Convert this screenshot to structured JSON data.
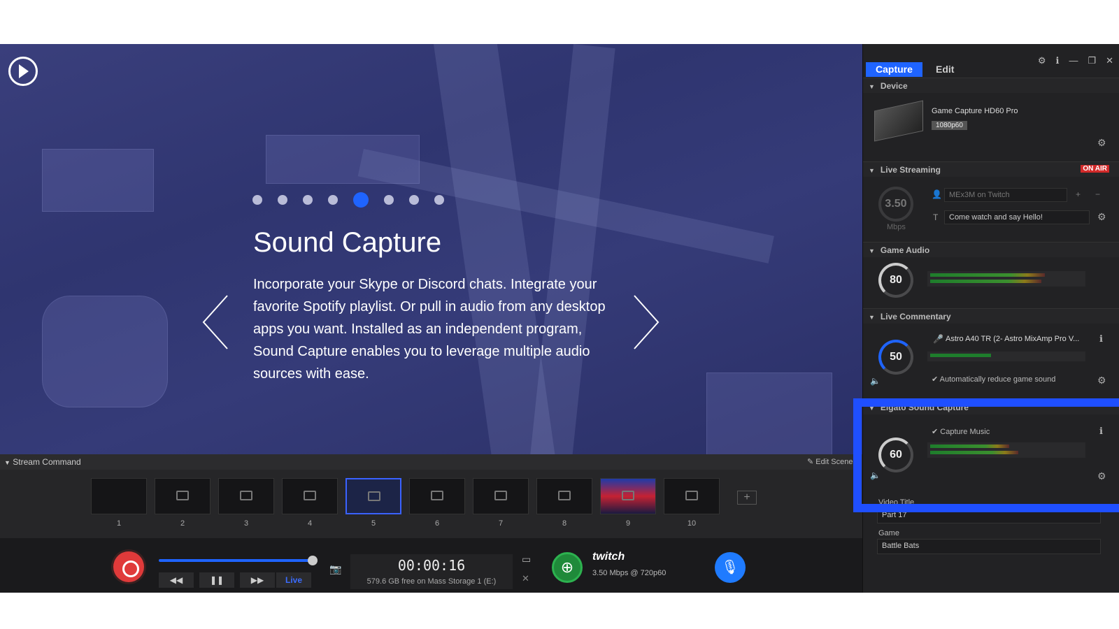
{
  "preview": {
    "slide_title": "Sound Capture",
    "slide_body": "Incorporate your Skype or Discord chats. Integrate your favorite Spotify playlist. Or pull in audio from any desktop apps you want. Installed as an independent program, Sound Capture enables you to leverage multiple audio sources with ease.",
    "slide_count": 8,
    "active_slide": 5
  },
  "stream_command": {
    "title": "Stream Command",
    "edit_scenes": "Edit Scenes",
    "scenes": [
      "1",
      "2",
      "3",
      "4",
      "5",
      "6",
      "7",
      "8",
      "9",
      "10"
    ],
    "selected_scene": "5"
  },
  "controls": {
    "timer": "00:00:16",
    "storage": "579.6 GB free on Mass Storage 1 (E:)",
    "live_label": "Live",
    "twitch_label": "twitch",
    "twitch_rate": "3.50 Mbps @ 720p60"
  },
  "panel": {
    "tabs": [
      "Capture",
      "Edit"
    ],
    "device": {
      "header": "Device",
      "name": "Game Capture HD60 Pro",
      "resolution": "1080p60"
    },
    "live_streaming": {
      "header": "Live Streaming",
      "status_badge": "ON AIR",
      "bitrate": "3.50",
      "bitrate_unit": "Mbps",
      "account": "MEx3M on Twitch",
      "stream_title": "Come watch and say Hello!"
    },
    "game_audio": {
      "header": "Game Audio",
      "level": "80"
    },
    "live_commentary": {
      "header": "Live Commentary",
      "level": "50",
      "device": "Astro A40 TR (2- Astro MixAmp Pro V...",
      "auto_reduce": "Automatically reduce game sound"
    },
    "sound_capture": {
      "header": "Elgato Sound Capture",
      "level": "60",
      "capture_music": "Capture Music"
    },
    "video_title_label": "Video Title",
    "video_title": "Part 17",
    "game_label": "Game",
    "game": "Battle Bats"
  },
  "colors": {
    "accent": "#1f64ff",
    "record": "#e03a3a",
    "on_air": "#d22a2a",
    "highlight": "#1f4fff"
  }
}
